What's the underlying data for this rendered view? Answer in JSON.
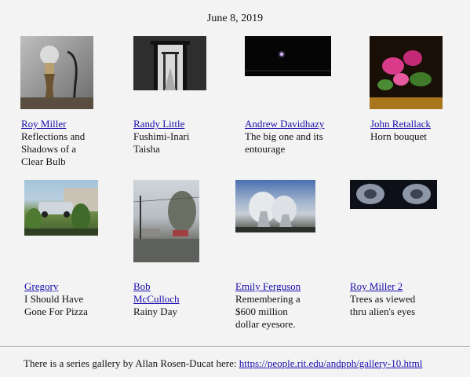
{
  "date": "June 8, 2019",
  "row1": [
    {
      "author": "Roy Miller",
      "title_lines": [
        "Reflections and",
        "Shadows of a",
        "Clear Bulb"
      ],
      "image": "lightbulb-photo"
    },
    {
      "author": "Randy Little",
      "title_lines": [
        "Fushimi-Inari",
        "Taisha"
      ],
      "image": "torii-gates-photo"
    },
    {
      "author": "Andrew Davidhazy",
      "title_lines": [
        "The big one and its",
        "entourage"
      ],
      "image": "night-sky-photo"
    },
    {
      "author": "John Retallack",
      "title_lines": [
        "Horn bouquet"
      ],
      "image": "flower-bouquet-photo"
    }
  ],
  "row2": [
    {
      "author": "Gregory",
      "title_lines": [
        "I Should Have",
        "Gone For Pizza"
      ],
      "image": "garden-car-photo"
    },
    {
      "author_lines": [
        "Bob",
        "McCulloch"
      ],
      "title_lines": [
        "Rainy Day"
      ],
      "image": "rainy-street-photo"
    },
    {
      "author": "Emily Ferguson",
      "title_lines": [
        "Remembering a",
        "$600 million",
        "dollar eyesore."
      ],
      "image": "cooling-towers-photo"
    },
    {
      "author": "Roy Miller 2",
      "title_lines": [
        "Trees as viewed",
        "thru alien's eyes"
      ],
      "image": "alien-eyes-photo"
    }
  ],
  "footer": {
    "text": "There is a series gallery by Allan Rosen-Ducat here: ",
    "link": "https://people.rit.edu/andpph/gallery-10.html"
  }
}
